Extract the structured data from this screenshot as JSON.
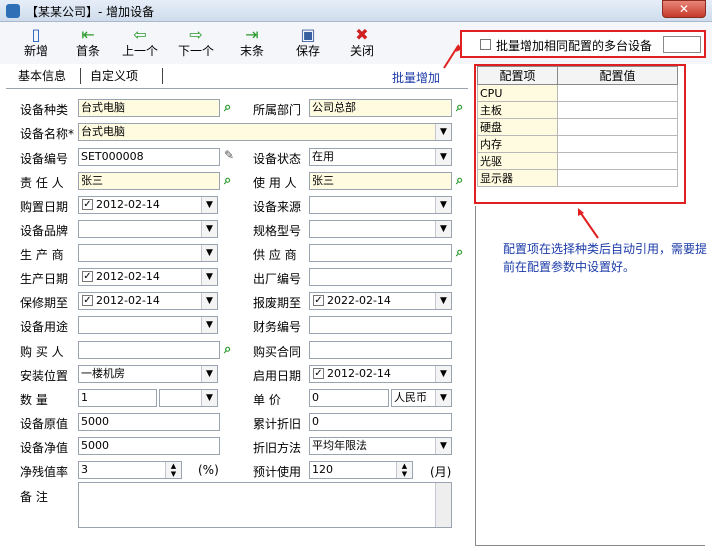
{
  "window": {
    "title": "【某某公司】- 增加设备",
    "close_label": "✕"
  },
  "toolbar": [
    {
      "key": "new",
      "label": "新增",
      "icon": "new-icon",
      "glyph": "▯",
      "color": "#1f5fb4"
    },
    {
      "key": "first",
      "label": "首条",
      "icon": "first-icon",
      "glyph": "⇤",
      "color": "#2a9a2a"
    },
    {
      "key": "prev",
      "label": "上一个",
      "icon": "prev-icon",
      "glyph": "⇦",
      "color": "#2a9a2a"
    },
    {
      "key": "next",
      "label": "下一个",
      "icon": "next-icon",
      "glyph": "⇨",
      "color": "#2a9a2a"
    },
    {
      "key": "last",
      "label": "末条",
      "icon": "last-icon",
      "glyph": "⇥",
      "color": "#2a9a2a"
    },
    {
      "key": "save",
      "label": "保存",
      "icon": "save-icon",
      "glyph": "▣",
      "color": "#3a5fa0"
    },
    {
      "key": "close",
      "label": "关闭",
      "icon": "close-icon",
      "glyph": "✖",
      "color": "#d02020"
    }
  ],
  "batch": {
    "label": "批量增加相同配置的多台设备",
    "count": "",
    "link": "批量增加"
  },
  "tabs": [
    "基本信息",
    "自定义项"
  ],
  "form": {
    "device_type": {
      "label": "设备种类",
      "value": "台式电脑"
    },
    "department": {
      "label": "所属部门",
      "value": "公司总部"
    },
    "device_name": {
      "label": "设备名称*",
      "value": "台式电脑"
    },
    "device_no": {
      "label": "设备编号",
      "value": "SET000008"
    },
    "status": {
      "label": "设备状态",
      "value": "在用"
    },
    "owner": {
      "label": "责 任 人",
      "value": "张三"
    },
    "user": {
      "label": "使 用 人",
      "value": "张三"
    },
    "purchase_date": {
      "label": "购置日期",
      "value": "2012-02-14",
      "checked": true
    },
    "source": {
      "label": "设备来源",
      "value": ""
    },
    "brand": {
      "label": "设备品牌",
      "value": ""
    },
    "model": {
      "label": "规格型号",
      "value": ""
    },
    "manufacturer": {
      "label": "生 产 商",
      "value": ""
    },
    "supplier": {
      "label": "供 应 商",
      "value": ""
    },
    "production_date": {
      "label": "生产日期",
      "value": "2012-02-14",
      "checked": true
    },
    "factory_no": {
      "label": "出厂编号",
      "value": ""
    },
    "warranty": {
      "label": "保修期至",
      "value": "2012-02-14",
      "checked": true
    },
    "scrap": {
      "label": "报废期至",
      "value": "2022-02-14",
      "checked": true
    },
    "usage": {
      "label": "设备用途",
      "value": ""
    },
    "finance_no": {
      "label": "财务编号",
      "value": ""
    },
    "buyer": {
      "label": "购 买 人",
      "value": ""
    },
    "contract": {
      "label": "购买合同",
      "value": ""
    },
    "location": {
      "label": "安装位置",
      "value": "一楼机房"
    },
    "start_date": {
      "label": "启用日期",
      "value": "2012-02-14",
      "checked": true
    },
    "qty": {
      "label": "数 量",
      "value": "1",
      "unit": ""
    },
    "unit_price": {
      "label": "单 价",
      "value": "0",
      "currency": "人民币"
    },
    "orig_value": {
      "label": "设备原值",
      "value": "5000"
    },
    "acc_depr": {
      "label": "累计折旧",
      "value": "0"
    },
    "net_value": {
      "label": "设备净值",
      "value": "5000"
    },
    "depr_method": {
      "label": "折旧方法",
      "value": "平均年限法"
    },
    "residual": {
      "label": "净残值率",
      "value": "3",
      "unit": "(%)"
    },
    "expected_use": {
      "label": "预计使用",
      "value": "120",
      "unit": "(月)"
    },
    "remark": {
      "label": "备 注",
      "value": ""
    }
  },
  "config": {
    "headers": [
      "配置项",
      "配置值"
    ],
    "rows": [
      {
        "item": "CPU",
        "value": ""
      },
      {
        "item": "主板",
        "value": ""
      },
      {
        "item": "硬盘",
        "value": ""
      },
      {
        "item": "内存",
        "value": ""
      },
      {
        "item": "光驱",
        "value": ""
      },
      {
        "item": "显示器",
        "value": ""
      }
    ]
  },
  "note": "配置项在选择种类后自动引用，需要提前在配置参数中设置好。",
  "colors": {
    "annotation_red": "#e02020",
    "link_blue": "#1b3ba8",
    "field_yellow": "#fffbe0"
  }
}
